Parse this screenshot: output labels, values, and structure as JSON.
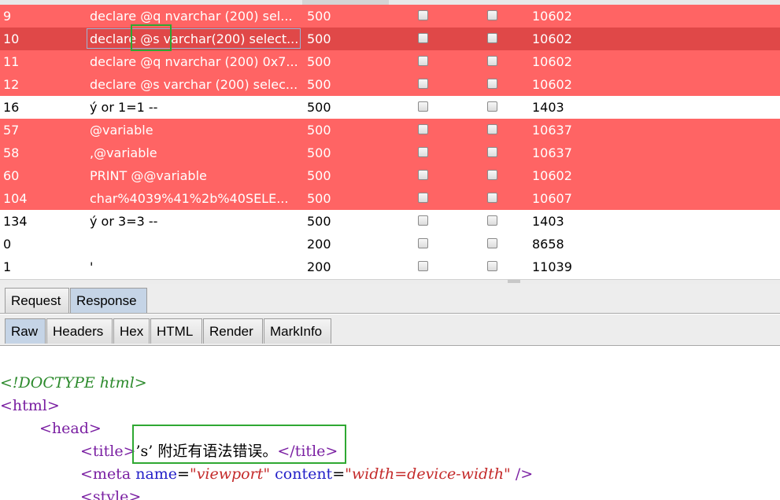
{
  "colors": {
    "error_row": "#ff6464",
    "selected_row": "#e04848",
    "normal_row": "#ffffff",
    "highlight_box": "#2fa832",
    "active_tab": "#c5d4e6"
  },
  "results": {
    "rows": [
      {
        "num": "9",
        "payload": "declare @q nvarchar (200) sel...",
        "status": "500",
        "length": "10602",
        "style": "red"
      },
      {
        "num": "10",
        "payload": "declare @s varchar(200) select...",
        "status": "500",
        "length": "10602",
        "style": "sel"
      },
      {
        "num": "11",
        "payload": "declare @q nvarchar (200) 0x7...",
        "status": "500",
        "length": "10602",
        "style": "red"
      },
      {
        "num": "12",
        "payload": "declare @s varchar (200) selec...",
        "status": "500",
        "length": "10602",
        "style": "red"
      },
      {
        "num": "16",
        "payload": "ý or 1=1 --",
        "status": "500",
        "length": "1403",
        "style": "white"
      },
      {
        "num": "57",
        "payload": "@variable",
        "status": "500",
        "length": "10637",
        "style": "red"
      },
      {
        "num": "58",
        "payload": ",@variable",
        "status": "500",
        "length": "10637",
        "style": "red"
      },
      {
        "num": "60",
        "payload": "PRINT @@variable",
        "status": "500",
        "length": "10602",
        "style": "red"
      },
      {
        "num": "104",
        "payload": "char%4039%41%2b%40SELE...",
        "status": "500",
        "length": "10607",
        "style": "red"
      },
      {
        "num": "134",
        "payload": "ý or 3=3 --",
        "status": "500",
        "length": "1403",
        "style": "white"
      },
      {
        "num": "0",
        "payload": "",
        "status": "200",
        "length": "8658",
        "style": "white"
      },
      {
        "num": "1",
        "payload": "'",
        "status": "200",
        "length": "11039",
        "style": "white"
      }
    ]
  },
  "tabs_top": [
    {
      "label": "Request",
      "active": false
    },
    {
      "label": "Response",
      "active": true
    }
  ],
  "tabs_view": [
    {
      "label": "Raw",
      "active": true
    },
    {
      "label": "Headers",
      "active": false
    },
    {
      "label": "Hex",
      "active": false
    },
    {
      "label": "HTML",
      "active": false
    },
    {
      "label": "Render",
      "active": false
    },
    {
      "label": "MarkInfo",
      "active": false
    }
  ],
  "response_body": {
    "line1": "<!DOCTYPE html>",
    "line2_tag": "html",
    "line3_tag": "head",
    "line4_tag": "title",
    "line4_text": "’s’ 附近有语法错误。",
    "line5_tag": "meta",
    "line5_attr1": "name",
    "line5_val1": "\"viewport\"",
    "line5_attr2": "content",
    "line5_val2": "\"width=device-width\"",
    "line6_tag": "style"
  }
}
